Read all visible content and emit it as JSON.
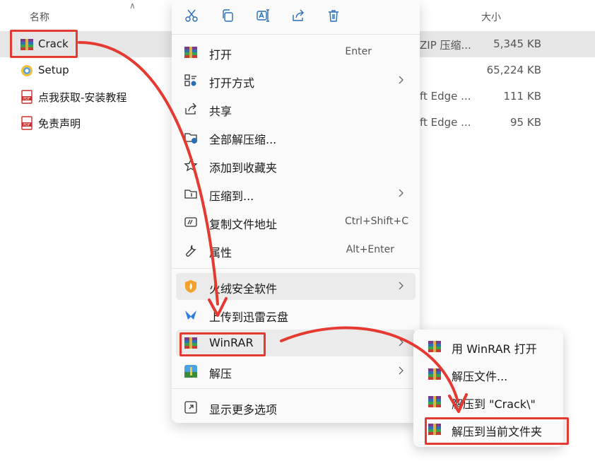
{
  "columns": {
    "name": "名称",
    "size": "大小"
  },
  "files": [
    {
      "name": "Crack",
      "type": "ZIP 压缩...",
      "size": "5,345 KB",
      "icon": "winrar-archive-icon",
      "selected": true
    },
    {
      "name": "Setup",
      "type": "",
      "size": "65,224 KB",
      "icon": "setup-app-icon"
    },
    {
      "name": "点我获取-安装教程",
      "type": "ft Edge ...",
      "size": "111 KB",
      "icon": "pdf-file-icon"
    },
    {
      "name": "免责声明",
      "type": "ft Edge ...",
      "size": "95 KB",
      "icon": "pdf-file-icon"
    }
  ],
  "context_menu": {
    "toolbar": [
      "cut-icon",
      "copy-icon",
      "rename-icon",
      "share-icon",
      "delete-icon"
    ],
    "items": [
      {
        "label": "打开",
        "shortcut": "Enter",
        "icon": "winrar-icon"
      },
      {
        "label": "打开方式",
        "submenu": true,
        "icon": "open-with-icon"
      },
      {
        "label": "共享",
        "icon": "share-icon"
      },
      {
        "label": "全部解压缩...",
        "icon": "extract-all-icon"
      },
      {
        "label": "添加到收藏夹",
        "icon": "star-icon"
      },
      {
        "label": "压缩到...",
        "submenu": true,
        "icon": "folder-compress-icon"
      },
      {
        "label": "复制文件地址",
        "shortcut": "Ctrl+Shift+C",
        "icon": "copy-path-icon"
      },
      {
        "label": "属性",
        "shortcut": "Alt+Enter",
        "icon": "wrench-icon"
      },
      {
        "label": "火绒安全软件",
        "submenu": true,
        "icon": "huorong-shield-icon"
      },
      {
        "label": "上传到迅雷云盘",
        "icon": "xunlei-bird-icon"
      },
      {
        "label": "WinRAR",
        "submenu": true,
        "icon": "winrar-icon"
      },
      {
        "label": "解压",
        "submenu": true,
        "icon": "unzip-tool-icon"
      },
      {
        "label": "显示更多选项",
        "icon": "more-options-icon"
      }
    ]
  },
  "winrar_submenu": [
    {
      "label": "用 WinRAR 打开"
    },
    {
      "label": "解压文件..."
    },
    {
      "label": "解压到 \"Crack\\\""
    },
    {
      "label": "解压到当前文件夹"
    }
  ],
  "colors": {
    "annotation": "#e53a31",
    "selection": "#e6e6e6",
    "menu_bg": "#fafafa"
  }
}
